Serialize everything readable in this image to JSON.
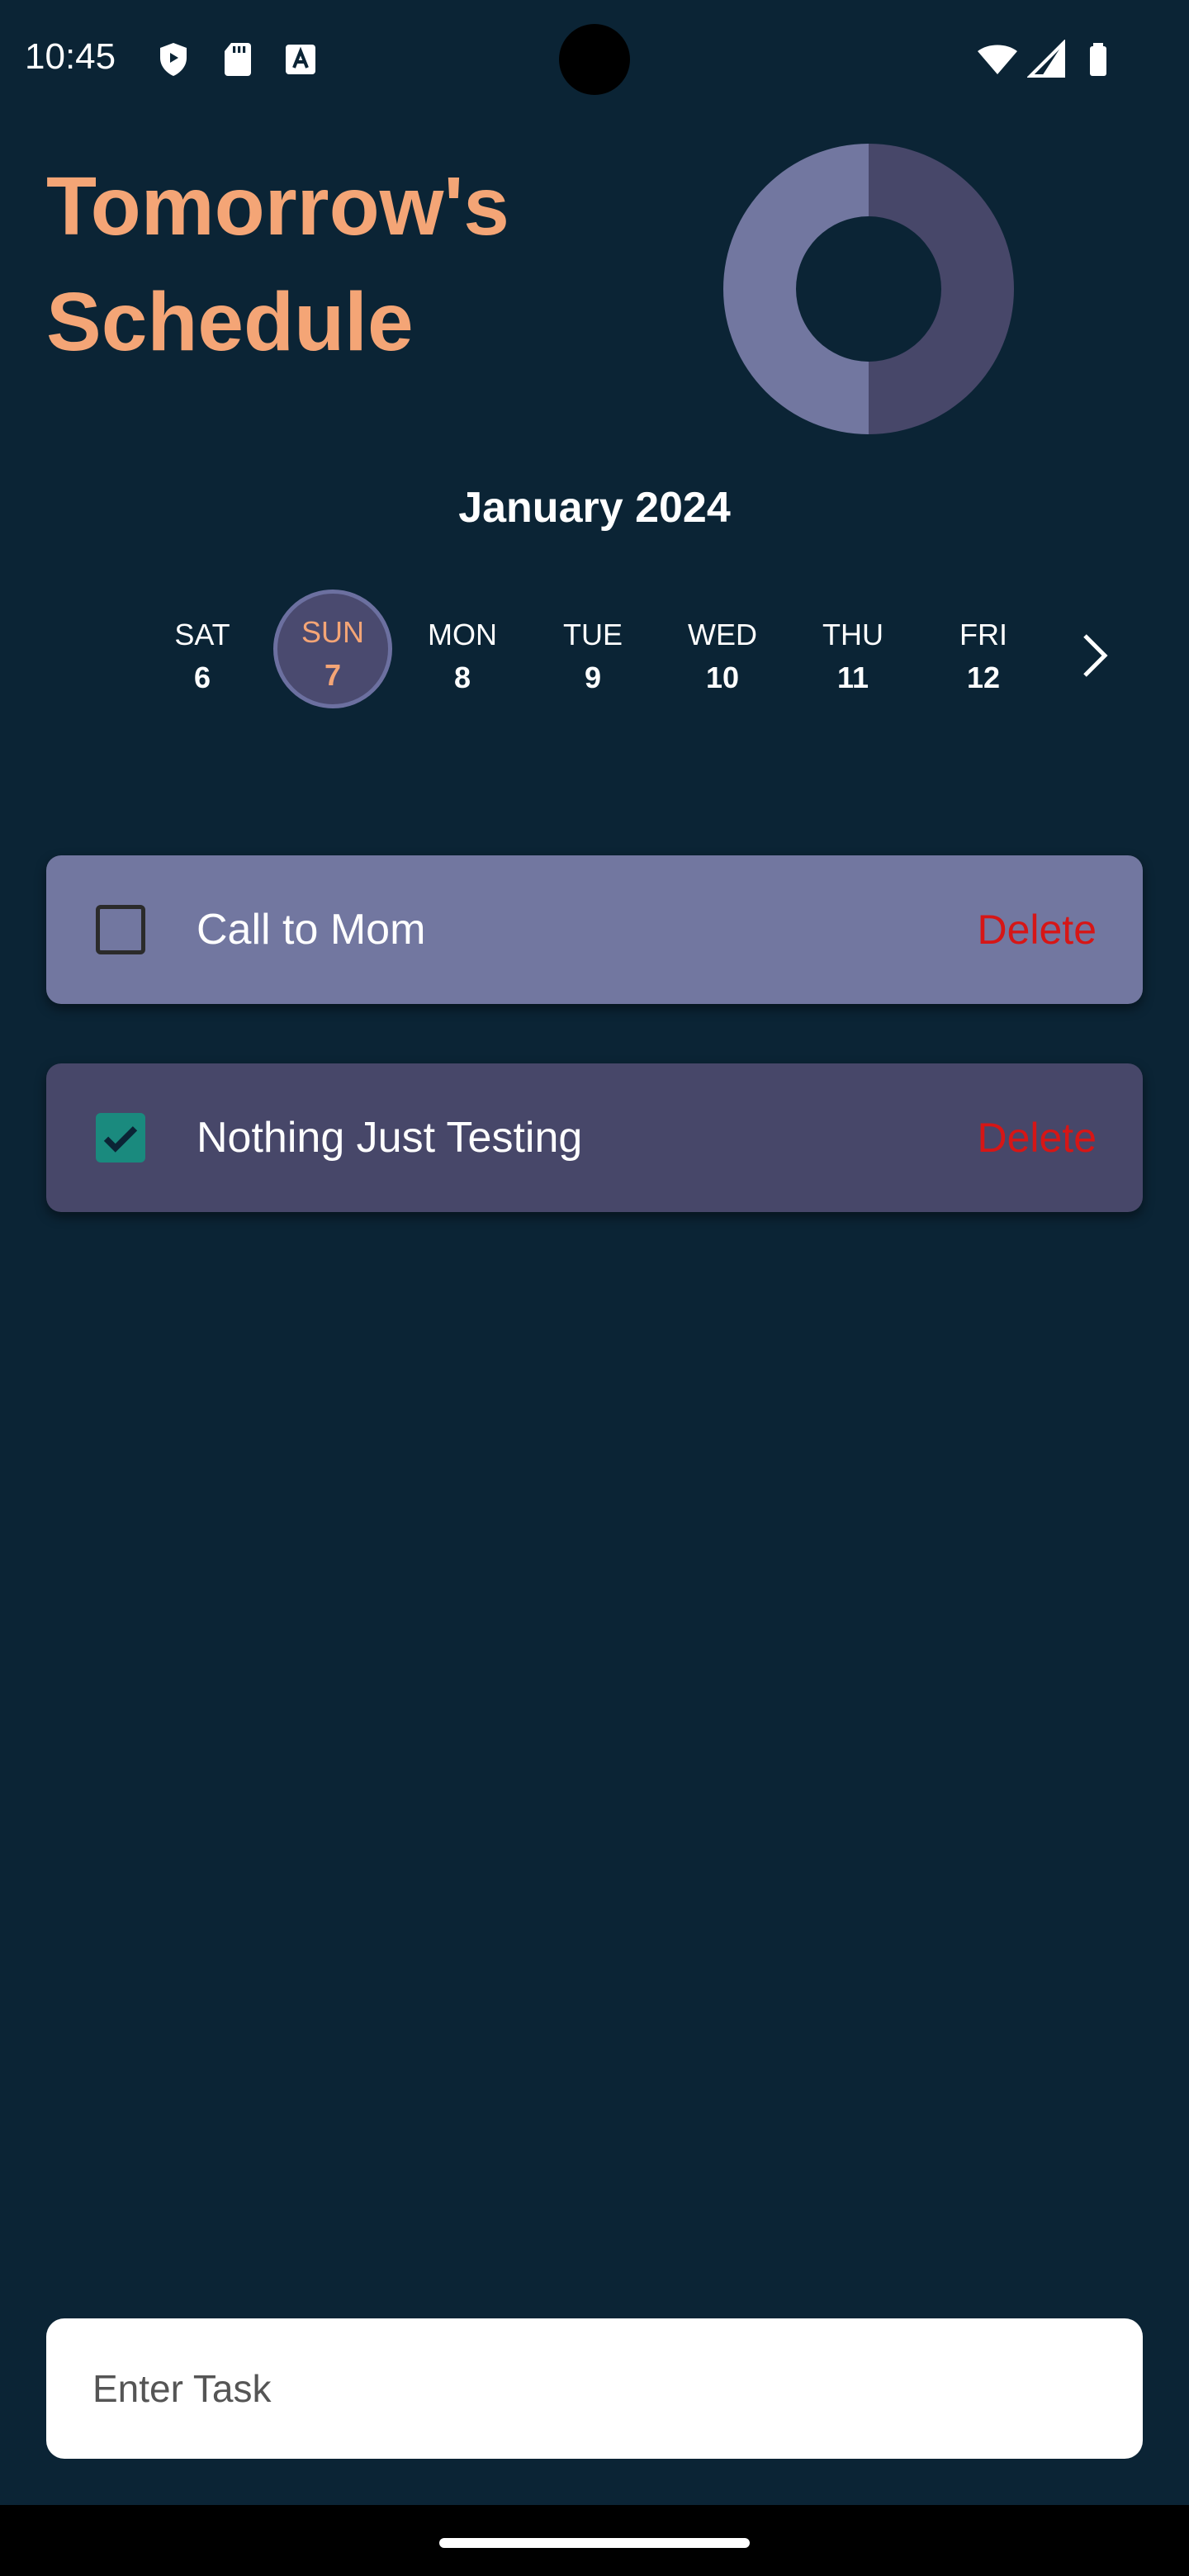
{
  "status_bar": {
    "time": "10:45"
  },
  "header": {
    "title": "Tomorrow's Schedule"
  },
  "chart_data": {
    "type": "pie",
    "values": [
      50,
      50
    ],
    "colors": [
      "#474769",
      "#7277a0"
    ]
  },
  "calendar": {
    "month": "January 2024",
    "days": [
      {
        "name": "SAT",
        "date": "6"
      },
      {
        "name": "SUN",
        "date": "7",
        "selected": true
      },
      {
        "name": "MON",
        "date": "8"
      },
      {
        "name": "TUE",
        "date": "9"
      },
      {
        "name": "WED",
        "date": "10"
      },
      {
        "name": "THU",
        "date": "11"
      },
      {
        "name": "FRI",
        "date": "12"
      }
    ]
  },
  "tasks": [
    {
      "label": "Call to Mom",
      "checked": false,
      "delete_label": "Delete"
    },
    {
      "label": "Nothing Just Testing",
      "checked": true,
      "delete_label": "Delete"
    }
  ],
  "input": {
    "placeholder": "Enter Task"
  },
  "colors": {
    "background": "#0b2435",
    "accent": "#f4a576",
    "delete": "#d61616",
    "checked": "#1a8a7e"
  }
}
